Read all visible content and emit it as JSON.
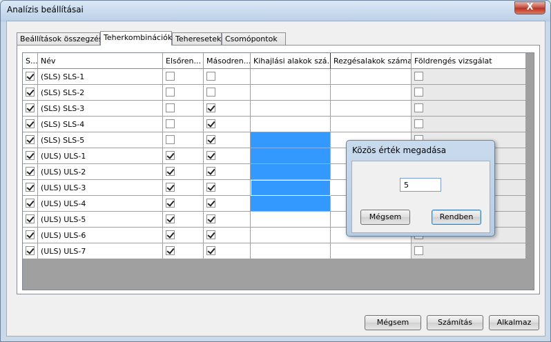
{
  "window": {
    "title": "Analízis beállításai",
    "close_label": "X"
  },
  "tabs": [
    {
      "label": "Beállítások összegzése",
      "active": false
    },
    {
      "label": "Teherkombinációk",
      "active": true
    },
    {
      "label": "Teheresetek",
      "active": false
    },
    {
      "label": "Csomópontok",
      "active": false
    }
  ],
  "grid": {
    "columns": [
      "S...",
      "Név",
      "Elsőren...",
      "Másodren...",
      "Kihajlási alakok szá...",
      "Rezgésalakok száma",
      "Földrengés vizsgálat"
    ],
    "rows": [
      {
        "select": true,
        "name": "(SLS) SLS-1",
        "first": false,
        "second": false,
        "buckling_selected": false
      },
      {
        "select": true,
        "name": "(SLS) SLS-2",
        "first": false,
        "second": false,
        "buckling_selected": false
      },
      {
        "select": true,
        "name": "(SLS) SLS-3",
        "first": false,
        "second": true,
        "buckling_selected": false
      },
      {
        "select": true,
        "name": "(SLS) SLS-4",
        "first": false,
        "second": true,
        "buckling_selected": false
      },
      {
        "select": true,
        "name": "(SLS) SLS-5",
        "first": false,
        "second": true,
        "buckling_selected": true
      },
      {
        "select": true,
        "name": "(ULS) ULS-1",
        "first": true,
        "second": true,
        "buckling_selected": true
      },
      {
        "select": true,
        "name": "(ULS) ULS-2",
        "first": true,
        "second": true,
        "buckling_selected": true
      },
      {
        "select": true,
        "name": "(ULS) ULS-3",
        "first": true,
        "second": true,
        "buckling_selected": true
      },
      {
        "select": true,
        "name": "(ULS) ULS-4",
        "first": true,
        "second": true,
        "buckling_selected": true
      },
      {
        "select": true,
        "name": "(ULS) ULS-5",
        "first": true,
        "second": true,
        "buckling_selected": false
      },
      {
        "select": true,
        "name": "(ULS) ULS-6",
        "first": true,
        "second": true,
        "buckling_selected": false
      },
      {
        "select": true,
        "name": "(ULS) ULS-7",
        "first": true,
        "second": true,
        "buckling_selected": false
      }
    ]
  },
  "dialog": {
    "title": "Közös érték megadása",
    "value": "5",
    "cancel_label": "Mégsem",
    "ok_label": "Rendben"
  },
  "footer": {
    "cancel_label": "Mégsem",
    "compute_label": "Számítás",
    "apply_label": "Alkalmaz"
  },
  "colors": {
    "selection": "#3399ff",
    "grid_background": "#a0a0a0"
  }
}
